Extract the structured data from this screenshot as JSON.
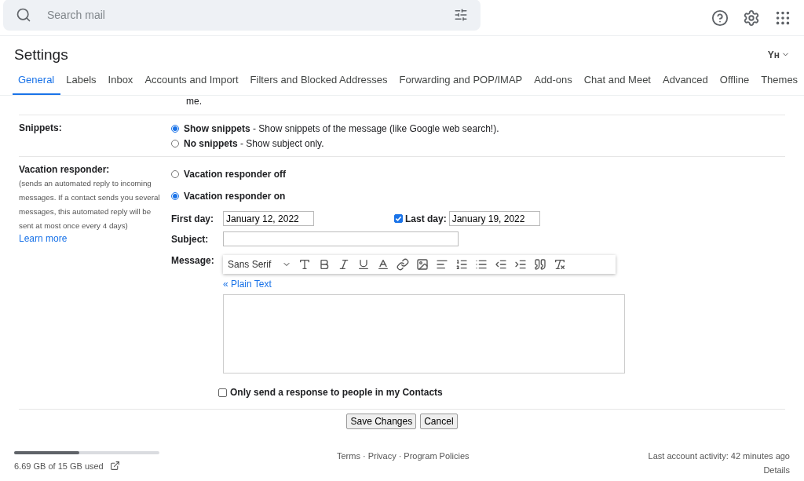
{
  "search": {
    "placeholder": "Search mail"
  },
  "title": "Settings",
  "account_badge": "Yʜ",
  "tabs": [
    {
      "label": "General",
      "selected": true
    },
    {
      "label": "Labels",
      "selected": false
    },
    {
      "label": "Inbox",
      "selected": false
    },
    {
      "label": "Accounts and Import",
      "selected": false
    },
    {
      "label": "Filters and Blocked Addresses",
      "selected": false
    },
    {
      "label": "Forwarding and POP/IMAP",
      "selected": false
    },
    {
      "label": "Add-ons",
      "selected": false
    },
    {
      "label": "Chat and Meet",
      "selected": false
    },
    {
      "label": "Advanced",
      "selected": false
    },
    {
      "label": "Offline",
      "selected": false
    },
    {
      "label": "Themes",
      "selected": false
    }
  ],
  "cut_text": "me.",
  "snippets": {
    "label": "Snippets:",
    "options": [
      {
        "title": "Show snippets",
        "desc": " - Show snippets of the message (like Google web search!).",
        "selected": true
      },
      {
        "title": "No snippets",
        "desc": " - Show subject only.",
        "selected": false
      }
    ]
  },
  "vacation": {
    "label": "Vacation responder:",
    "note": "(sends an automated reply to incoming messages. If a contact sends you several messages, this automated reply will be sent at most once every 4 days)",
    "learn_more": "Learn more",
    "options": [
      {
        "title": "Vacation responder off",
        "selected": false
      },
      {
        "title": "Vacation responder on",
        "selected": true
      }
    ],
    "first_day_label": "First day:",
    "first_day": "January 12, 2022",
    "last_day_label": "Last day:",
    "last_day_checked": true,
    "last_day": "January 19, 2022",
    "subject_label": "Subject:",
    "message_label": "Message:",
    "font": "Sans Serif",
    "plain_text": "« Plain Text",
    "contacts_only": {
      "label": "Only send a response to people in my Contacts",
      "checked": false
    }
  },
  "buttons": [
    "Save Changes",
    "Cancel"
  ],
  "footer": {
    "storage": {
      "level": 0.446,
      "text": "6.69 GB of 15 GB used"
    },
    "links": [
      "Terms",
      "Privacy",
      "Program Policies"
    ],
    "separator": "·",
    "activity": "Last account activity: 42 minutes ago",
    "details": "Details"
  }
}
